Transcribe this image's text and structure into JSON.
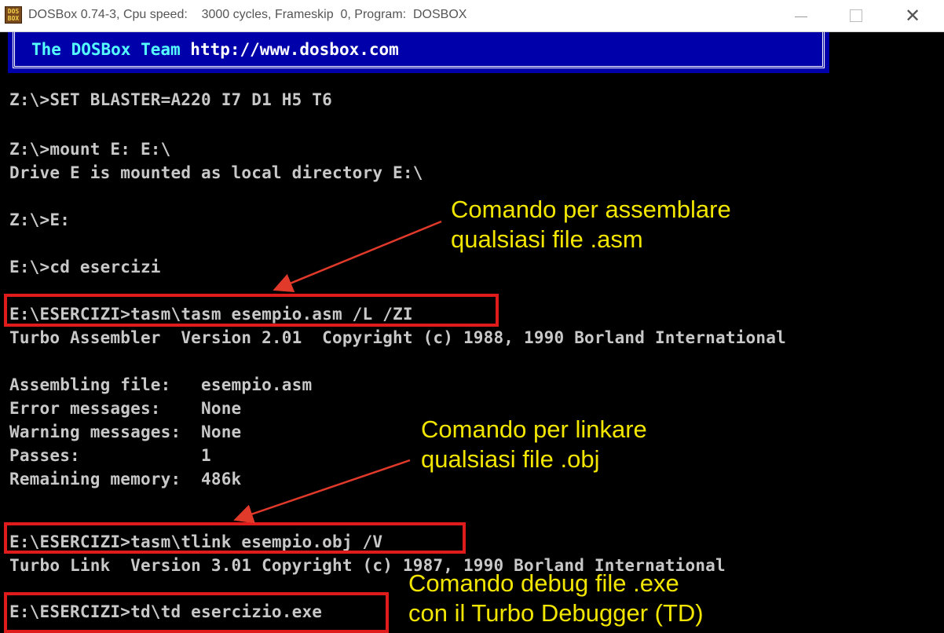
{
  "window": {
    "title": "DOSBox 0.74-3, Cpu speed:    3000 cycles, Frameskip  0, Program:  DOSBOX",
    "icon": "dosbox-icon",
    "icon_text": "DOS\nBOX",
    "controls": {
      "minimize": "minimize-icon",
      "maximize": "maximize-icon",
      "close": "close-icon",
      "close_glyph": "✕"
    }
  },
  "banner": {
    "team": "The DOSBox Team ",
    "url": "http://www.dosbox.com"
  },
  "terminal": {
    "lines": [
      "Z:\\>SET BLASTER=A220 I7 D1 H5 T6",
      "Z:\\>mount E: E:\\",
      "Drive E is mounted as local directory E:\\",
      "Z:\\>E:",
      "E:\\>cd esercizi",
      "E:\\ESERCIZI>tasm\\tasm esempio.asm /L /ZI",
      "Turbo Assembler  Version 2.01  Copyright (c) 1988, 1990 Borland International",
      "Assembling file:   esempio.asm",
      "Error messages:    None",
      "Warning messages:  None",
      "Passes:            1",
      "Remaining memory:  486k",
      "E:\\ESERCIZI>tasm\\tlink esempio.obj /V",
      "Turbo Link  Version 3.01 Copyright (c) 1987, 1990 Borland International",
      "E:\\ESERCIZI>td\\td esercizio.exe"
    ]
  },
  "annotations": {
    "assemble": "Comando per assemblare\nqualsiasi file .asm",
    "link": "Comando per linkare\nqualsiasi file .obj",
    "debug": "Comando debug file .exe\ncon il Turbo Debugger (TD)"
  },
  "colors": {
    "highlight": "#e01b1b",
    "annotation_text": "#f2e600",
    "arrow": "#e23a2a",
    "banner_bg": "#0000aa",
    "terminal_text": "#c8c8c8"
  }
}
